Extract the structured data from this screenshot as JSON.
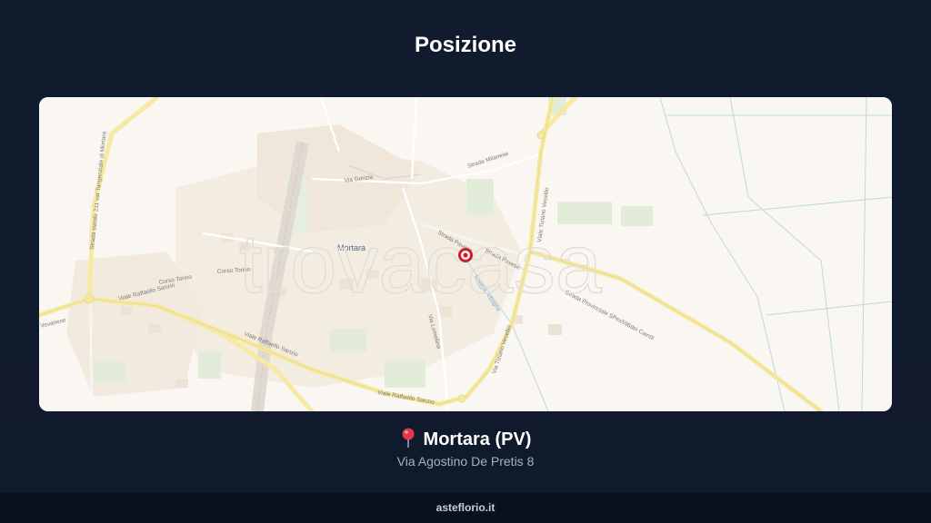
{
  "section": {
    "title": "Posizione"
  },
  "map": {
    "watermark": "trovacasa",
    "city_label": "Mortara",
    "street_labels": {
      "via_gorizia": "Via Gorizia",
      "strada_milanese": "Strada Milanese",
      "strada_pavese_1": "Strada Pavese",
      "strada_pavese_2": "Strada Pavese",
      "viale_tiziano_vecellio_1": "Viale Tiziano Vecellio",
      "viale_tiziano_vecellio_2": "Via Tiziano Vecellio",
      "strada_provinciale": "Strada Provinciale SPex596dei Cairoli",
      "corso_torino_1": "Corso Torino",
      "corso_torino_2": "Corso Torino",
      "viale_raffaello_sanzio_1": "Viale Raffaello Sanzio",
      "viale_raffaello_sanzio_2": "Viale Raffaello Sanzio",
      "viale_raffaello_sanzio_3": "Viale Raffaello Sanzio",
      "via_lomellina": "Via Lomellina",
      "strada_statale": "Strada statale 211 var Tangenziale di Mortara",
      "roggia_arbogna": "Roggia Arbogna",
      "vevanese": "Vevanese"
    },
    "marker_color": "#c8202c"
  },
  "location": {
    "pin_icon": "round-pushpin",
    "city": "Mortara (PV)",
    "address": "Via Agostino De Pretis 8"
  },
  "footer": {
    "site": "asteflorio.it"
  }
}
